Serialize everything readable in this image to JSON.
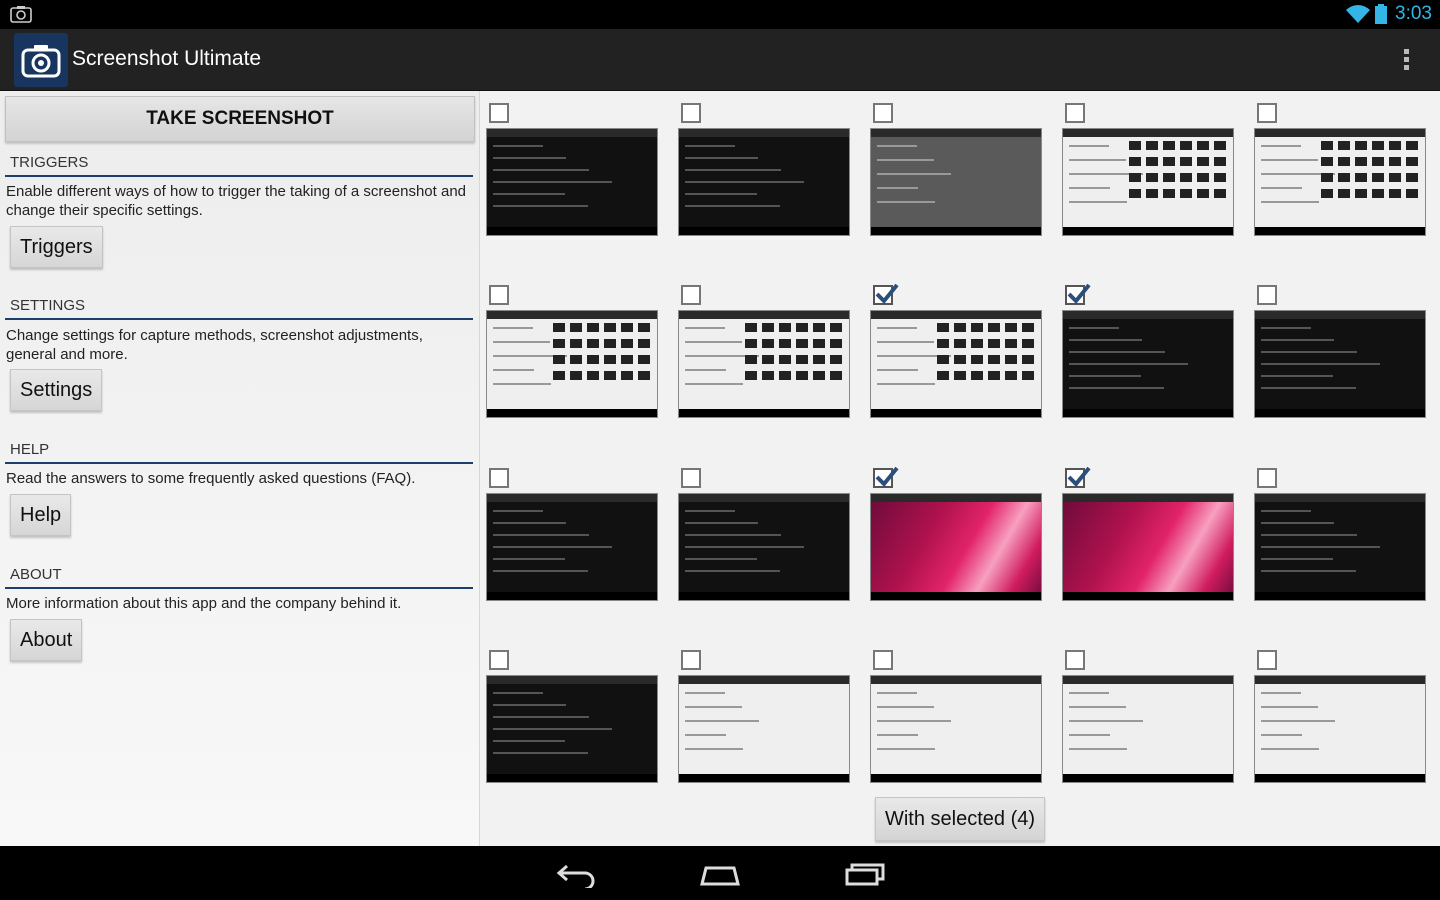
{
  "status_bar": {
    "time": "3:03",
    "accent": "#33b5e5"
  },
  "app_bar": {
    "title": "Screenshot Ultimate",
    "icon": "camera-icon"
  },
  "left_panel": {
    "take_button": "TAKE SCREENSHOT",
    "sections": [
      {
        "header": "TRIGGERS",
        "description": "Enable different ways of how to trigger the taking of a screenshot and change their specific settings.",
        "button": "Triggers"
      },
      {
        "header": "SETTINGS",
        "description": "Change settings for capture methods, screenshot adjustments, general and more.",
        "button": "Settings"
      },
      {
        "header": "HELP",
        "description": "Read the answers to some frequently asked questions (FAQ).",
        "button": "Help"
      },
      {
        "header": "ABOUT",
        "description": "More information about this app and the company behind it.",
        "button": "About"
      }
    ]
  },
  "grid": {
    "selected_count": 4,
    "with_selected_label": "With selected (4)",
    "checked": [
      false,
      false,
      false,
      false,
      false,
      false,
      false,
      true,
      true,
      false,
      false,
      false,
      true,
      true,
      false,
      false,
      false,
      false,
      false,
      false
    ]
  },
  "colors": {
    "section_line": "#1c3f6e",
    "background": "#f2f2f2"
  }
}
